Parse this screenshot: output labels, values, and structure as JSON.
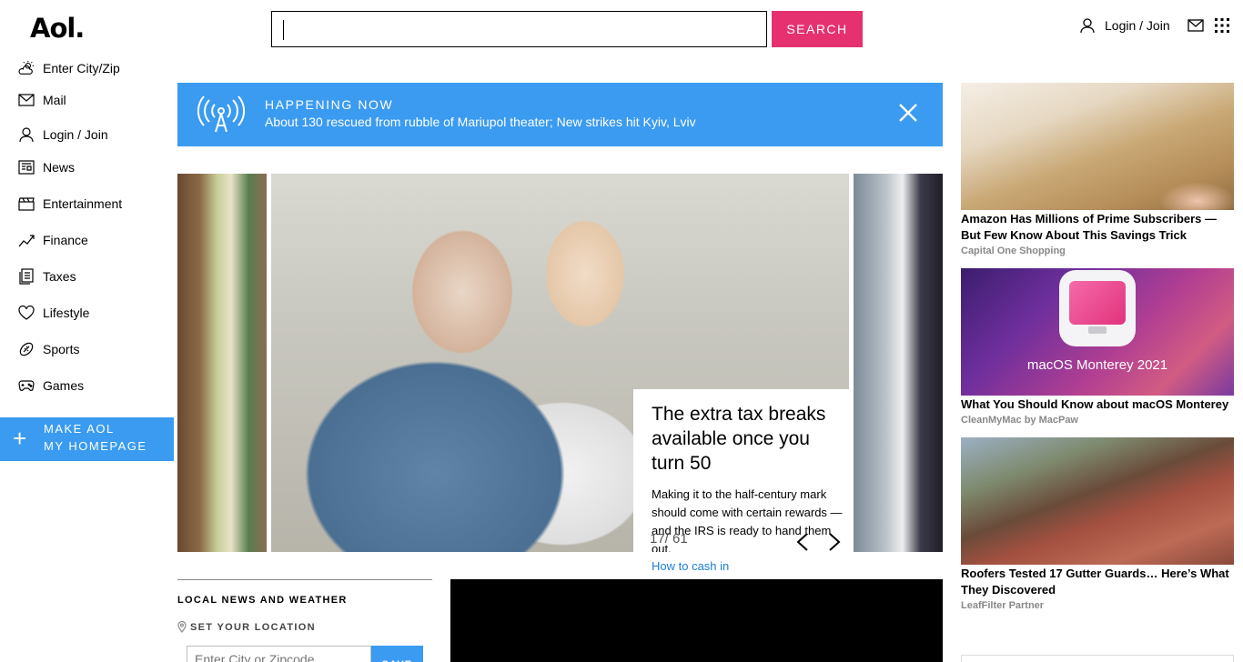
{
  "header": {
    "logo": "Aol.",
    "search_value": "",
    "search_button": "SEARCH",
    "login": "Login / Join"
  },
  "sidebar": {
    "items": [
      {
        "label": "Enter City/Zip",
        "icon": "weather-icon"
      },
      {
        "label": "Mail",
        "icon": "mail-icon"
      },
      {
        "label": "Login / Join",
        "icon": "user-icon"
      },
      {
        "label": "News",
        "icon": "news-icon"
      },
      {
        "label": "Entertainment",
        "icon": "clapper-icon"
      },
      {
        "label": "Finance",
        "icon": "chart-icon"
      },
      {
        "label": "Taxes",
        "icon": "document-icon"
      },
      {
        "label": "Lifestyle",
        "icon": "heart-icon"
      },
      {
        "label": "Sports",
        "icon": "ball-icon"
      },
      {
        "label": "Games",
        "icon": "gamepad-icon"
      }
    ],
    "make_home_line1": "MAKE AOL",
    "make_home_line2": "MY HOMEPAGE"
  },
  "banner": {
    "label": "HAPPENING NOW",
    "text": "About 130 rescued from rubble of Mariupol theater; New strikes hit Kyiv, Lviv"
  },
  "carousel": {
    "title": "The extra tax breaks available once you turn 50",
    "description": "Making it to the half-century mark should come with certain rewards — and the IRS is ready to hand them out.",
    "link": "How to cash in",
    "counter": "17/ 61"
  },
  "local": {
    "heading": "LOCAL NEWS AND WEATHER",
    "set_location": "SET YOUR LOCATION",
    "zip_placeholder": "Enter City or Zipcode",
    "save": "SAVE"
  },
  "ads": [
    {
      "title": "Amazon Has Millions of Prime Subscribers — But Few Know About This Savings Trick",
      "source": "Capital One Shopping"
    },
    {
      "title": "What You Should Know about macOS Monterey",
      "source": "CleanMyMac by MacPaw",
      "image_caption": "macOS Monterey 2021"
    },
    {
      "title": "Roofers Tested 17 Gutter Guards… Here’s What They Discovered",
      "source": "LeafFilter Partner"
    }
  ],
  "colors": {
    "accent_pink": "#e5316f",
    "accent_blue": "#3a9bf0",
    "link_blue": "#1a7fd8"
  }
}
